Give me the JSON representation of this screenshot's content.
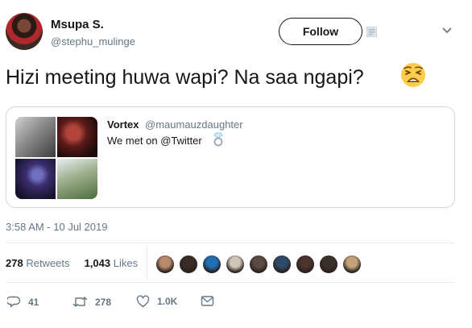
{
  "author": {
    "name": "Msupa S.",
    "handle": "@stephu_mulinge"
  },
  "follow_label": "Follow",
  "tweet": {
    "text": "Hizi meeting huwa wapi? Na saa ngapi?",
    "emoji": "weary-face-emoji"
  },
  "quoted": {
    "name": "Vortex",
    "handle": "@maumauzdaughter",
    "text": "We met on @Twitter",
    "emoji": "ring-icon"
  },
  "timestamp": "3:58 AM - 10 Jul 2019",
  "stats": {
    "retweets": "278",
    "retweets_label": "Retweets",
    "likes": "1,043",
    "likes_label": "Likes"
  },
  "likers": [
    "#b98a6a",
    "#3a2b26",
    "#1f6fb2",
    "#cfc7b8",
    "#5c4a44",
    "#2e4a6b",
    "#4a342c",
    "#3b2f2a",
    "#c4a27a"
  ],
  "actions": {
    "replies": "41",
    "retweets": "278",
    "likes": "1.0K"
  },
  "colors": {
    "text": "#14171a",
    "secondary": "#657786",
    "border": "#ccd6dd",
    "divider": "#e6ecf0"
  }
}
